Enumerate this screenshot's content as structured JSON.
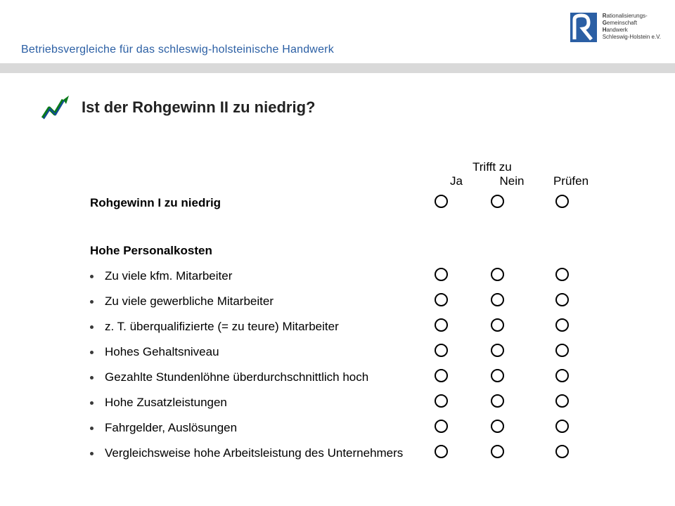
{
  "header": {
    "title": "Betriebsvergleiche für das schleswig-holsteinische Handwerk",
    "org_lines": [
      "Rationalisierungs-",
      "Gemeinschaft",
      "Handwerk",
      "Schleswig-Holstein e.V."
    ],
    "org_bold_initials": [
      "R",
      "G",
      "H"
    ]
  },
  "question": "Ist  der Rohgewinn II zu niedrig?",
  "columns": {
    "group": "Trifft zu",
    "ja": "Ja",
    "nein": "Nein",
    "pruefen": "Prüfen"
  },
  "rows": [
    {
      "kind": "main",
      "label": "Rohgewinn I zu niedrig",
      "circle": true
    },
    {
      "kind": "main",
      "label": "Hohe Personalkosten",
      "circle": false
    },
    {
      "kind": "sub",
      "label": "Zu viele kfm. Mitarbeiter",
      "circle": true
    },
    {
      "kind": "sub",
      "label": "Zu viele gewerbliche Mitarbeiter",
      "circle": true
    },
    {
      "kind": "sub",
      "label": "z. T. überqualifizierte (= zu teure) Mitarbeiter",
      "circle": true
    },
    {
      "kind": "sub",
      "label": "Hohes Gehaltsniveau",
      "circle": true
    },
    {
      "kind": "sub",
      "label": "Gezahlte Stundenlöhne überdurchschnittlich hoch",
      "circle": true
    },
    {
      "kind": "sub",
      "label": "Hohe Zusatzleistungen",
      "circle": true
    },
    {
      "kind": "sub",
      "label": "Fahrgelder, Auslösungen",
      "circle": true
    },
    {
      "kind": "sub",
      "label": "Vergleichsweise hohe Arbeitsleistung des Unternehmers",
      "circle": true
    }
  ]
}
